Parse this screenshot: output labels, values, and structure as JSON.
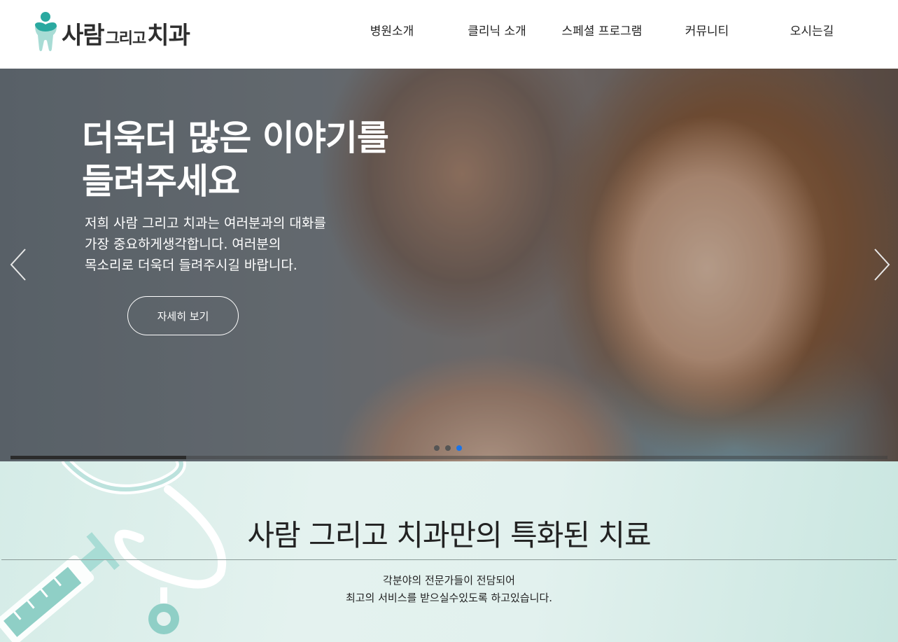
{
  "header": {
    "logo": {
      "part1": "사람",
      "part2": "그리고",
      "part3": "치과",
      "icon": "tooth-person-logo-icon"
    },
    "nav": [
      {
        "label": "병원소개"
      },
      {
        "label": "클리닉 소개"
      },
      {
        "label": "스페셜 프로그램"
      },
      {
        "label": "커뮤니티"
      },
      {
        "label": "오시는길"
      }
    ]
  },
  "hero": {
    "title_line1": "더욱더 많은 이야기를",
    "title_line2": "들려주세요",
    "desc_line1": "저희 사람 그리고 치과는 여러분과의 대화를",
    "desc_line2": "가장 중요하게생각합니다. 여러분의",
    "desc_line3": "목소리로 더욱더 들려주시길 바랍니다.",
    "button_label": "자세히 보기",
    "prev_icon": "chevron-left-icon",
    "next_icon": "chevron-right-icon",
    "slide_count": 3,
    "active_slide": 3,
    "progress": 0.2
  },
  "section": {
    "title": "사람 그리고 치과만의 특화된 치료",
    "text_line1": "각분야의 전문가들이 전담되어",
    "text_line2": "최고의 서비스를 받으실수있도록 하고있습니다.",
    "decoration_icons": [
      "stethoscope-icon",
      "syringe-icon"
    ]
  },
  "colors": {
    "brand_teal": "#2aa9a0",
    "brand_teal_light": "#9fd9d2",
    "text_dark": "#222222",
    "dot_active": "#1a73e8",
    "section_bg": "#dcefeb"
  }
}
